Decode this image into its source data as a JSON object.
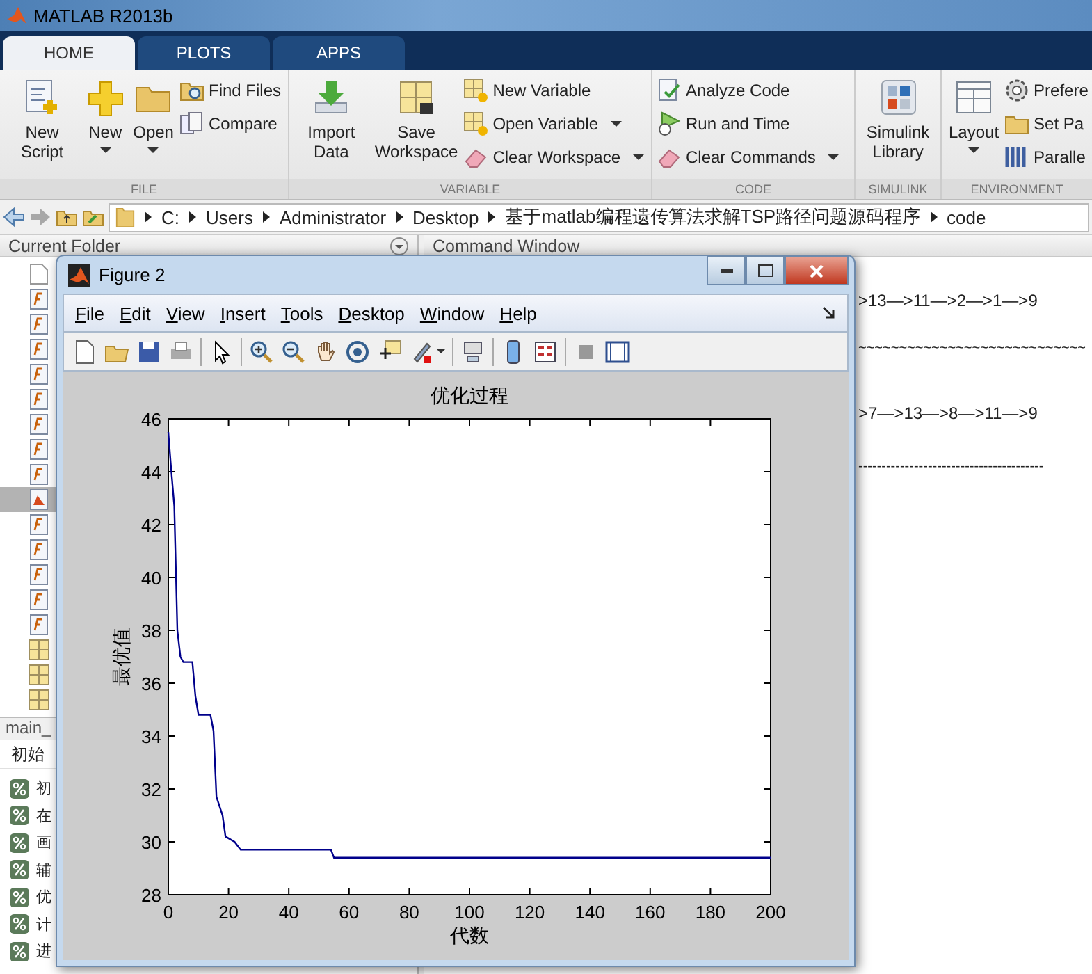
{
  "window": {
    "title": "MATLAB R2013b"
  },
  "tabs": [
    {
      "label": "HOME",
      "selected": true
    },
    {
      "label": "PLOTS",
      "selected": false
    },
    {
      "label": "APPS",
      "selected": false
    }
  ],
  "toolstrip": [
    {
      "label": "FILE",
      "columns": [
        {
          "kind": "large",
          "label": "New Script",
          "dropdown": false
        },
        {
          "kind": "large",
          "label": "New",
          "dropdown": true
        },
        {
          "kind": "large",
          "label": "Open",
          "dropdown": true
        },
        {
          "kind": "stack",
          "items": [
            {
              "label": "Find Files",
              "dropdown": false
            },
            {
              "label": "Compare",
              "dropdown": false
            }
          ]
        }
      ]
    },
    {
      "label": "VARIABLE",
      "columns": [
        {
          "kind": "large",
          "label": "Import Data",
          "dropdown": false
        },
        {
          "kind": "large",
          "label": "Save Workspace",
          "dropdown": false
        },
        {
          "kind": "stack",
          "items": [
            {
              "label": "New Variable",
              "dropdown": false
            },
            {
              "label": "Open Variable",
              "dropdown": true
            },
            {
              "label": "Clear Workspace",
              "dropdown": true
            }
          ]
        }
      ]
    },
    {
      "label": "CODE",
      "columns": [
        {
          "kind": "stack",
          "items": [
            {
              "label": "Analyze Code",
              "dropdown": false
            },
            {
              "label": "Run and Time",
              "dropdown": false
            },
            {
              "label": "Clear Commands",
              "dropdown": true
            }
          ]
        }
      ]
    },
    {
      "label": "SIMULINK",
      "columns": [
        {
          "kind": "large",
          "label": "Simulink Library",
          "dropdown": false
        }
      ]
    },
    {
      "label": "ENVIRONMENT",
      "columns": [
        {
          "kind": "large",
          "label": "Layout",
          "dropdown": true
        },
        {
          "kind": "stack",
          "items": [
            {
              "label": "Prefere",
              "dropdown": false
            },
            {
              "label": "Set Pa",
              "dropdown": false
            },
            {
              "label": "Paralle",
              "dropdown": false
            }
          ]
        }
      ]
    }
  ],
  "address": [
    "C:",
    "Users",
    "Administrator",
    "Desktop",
    "基于matlab编程遗传算法求解TSP路径问题源码程序",
    "code"
  ],
  "current_folder": {
    "title": "Current Folder",
    "files": [
      {
        "kind": "doc",
        "selected": false
      },
      {
        "kind": "function",
        "selected": false
      },
      {
        "kind": "function",
        "selected": false
      },
      {
        "kind": "function",
        "selected": false
      },
      {
        "kind": "function",
        "selected": false
      },
      {
        "kind": "function",
        "selected": false
      },
      {
        "kind": "function",
        "selected": false
      },
      {
        "kind": "function",
        "selected": false
      },
      {
        "kind": "function",
        "selected": false
      },
      {
        "kind": "figure",
        "selected": true
      },
      {
        "kind": "function",
        "selected": false
      },
      {
        "kind": "function",
        "selected": false
      },
      {
        "kind": "function",
        "selected": false
      },
      {
        "kind": "function",
        "selected": false
      },
      {
        "kind": "function",
        "selected": false
      },
      {
        "kind": "matfile",
        "selected": false
      },
      {
        "kind": "matfile",
        "selected": false
      },
      {
        "kind": "matfile",
        "selected": false
      }
    ],
    "details_title": "main_",
    "details_heading": "初始",
    "sections": [
      "初",
      "在",
      "画",
      "辅",
      "优",
      "计",
      "进"
    ]
  },
  "command_window": {
    "title": "Command Window",
    "lines": [
      ">13—>11—>2—>1—>9",
      "~~~~~~~~~~~~~~~~~~~~~~~~~~~~",
      ">7—>13—>8—>11—>9",
      "----------------------------------------"
    ]
  },
  "figure": {
    "title": "Figure 2",
    "menu": [
      "File",
      "Edit",
      "View",
      "Insert",
      "Tools",
      "Desktop",
      "Window",
      "Help"
    ],
    "chart_data": {
      "type": "line",
      "title": "优化过程",
      "xlabel": "代数",
      "ylabel": "最优值",
      "xlim": [
        0,
        200
      ],
      "ylim": [
        28,
        46
      ],
      "xticks": [
        0,
        20,
        40,
        60,
        80,
        100,
        120,
        140,
        160,
        180,
        200
      ],
      "yticks": [
        28,
        30,
        32,
        34,
        36,
        38,
        40,
        42,
        44,
        46
      ],
      "x": [
        0,
        1,
        2,
        3,
        4,
        5,
        8,
        9,
        10,
        14,
        15,
        16,
        18,
        19,
        22,
        24,
        54,
        55,
        200
      ],
      "series": [
        {
          "color": "#00008b",
          "values": [
            45.5,
            44,
            42.7,
            38,
            37,
            36.8,
            36.8,
            35.5,
            34.8,
            34.8,
            34.2,
            31.7,
            31,
            30.2,
            30,
            29.7,
            29.7,
            29.4,
            29.4
          ]
        }
      ]
    }
  }
}
